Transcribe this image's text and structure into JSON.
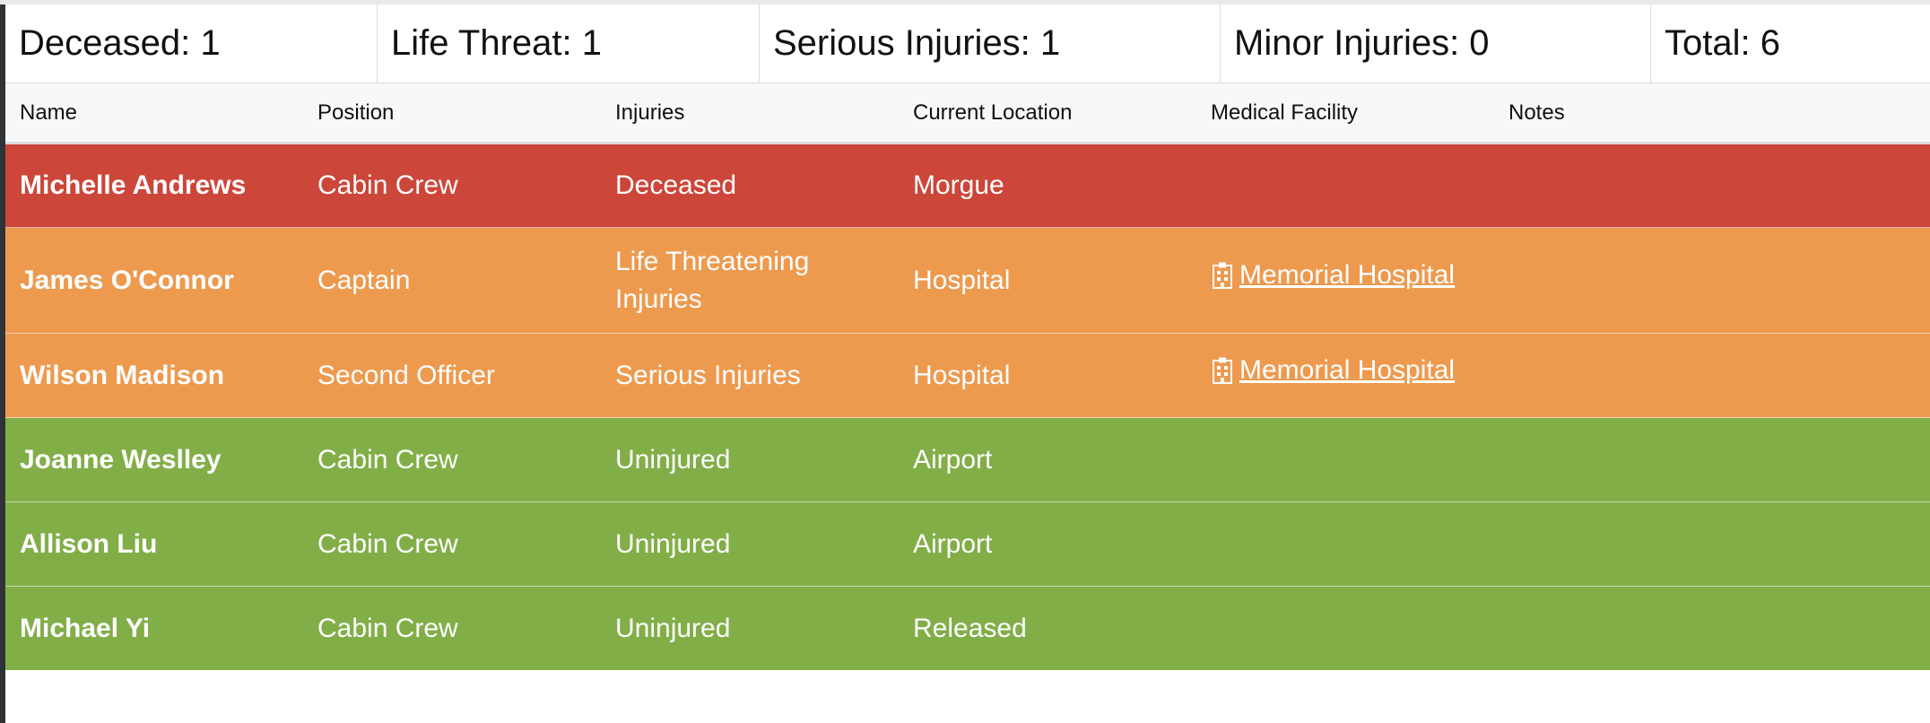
{
  "summary": [
    {
      "label": "Deceased: 1"
    },
    {
      "label": "Life Threat: 1"
    },
    {
      "label": "Serious Injuries: 1"
    },
    {
      "label": "Minor Injuries: 0"
    },
    {
      "label": "Total: 6"
    }
  ],
  "columns": [
    "Name",
    "Position",
    "Injuries",
    "Current Location",
    "Medical Facility",
    "Notes"
  ],
  "rows": [
    {
      "name": "Michelle Andrews",
      "position": "Cabin Crew",
      "injuries": "Deceased",
      "location": "Morgue",
      "facility": "",
      "notes": "",
      "status_color": "#cc463a"
    },
    {
      "name": "James O'Connor",
      "position": "Captain",
      "injuries": "Life Threatening Injuries",
      "location": "Hospital",
      "facility": " Memorial Hospital",
      "notes": "",
      "status_color": "#ed9a4f"
    },
    {
      "name": "Wilson Madison",
      "position": "Second Officer",
      "injuries": "Serious Injuries",
      "location": "Hospital",
      "facility": " Memorial Hospital",
      "notes": "",
      "status_color": "#ed9a4f"
    },
    {
      "name": "Joanne Weslley",
      "position": "Cabin Crew",
      "injuries": "Uninjured",
      "location": "Airport",
      "facility": "",
      "notes": "",
      "status_color": "#82ae48"
    },
    {
      "name": "Allison Liu",
      "position": "Cabin Crew",
      "injuries": "Uninjured",
      "location": "Airport",
      "facility": "",
      "notes": "",
      "status_color": "#82ae48"
    },
    {
      "name": "Michael Yi",
      "position": "Cabin Crew",
      "injuries": "Uninjured",
      "location": "Released",
      "facility": "",
      "notes": "",
      "status_color": "#82ae48"
    }
  ],
  "icons": {
    "facility": "hospital-building-icon"
  }
}
